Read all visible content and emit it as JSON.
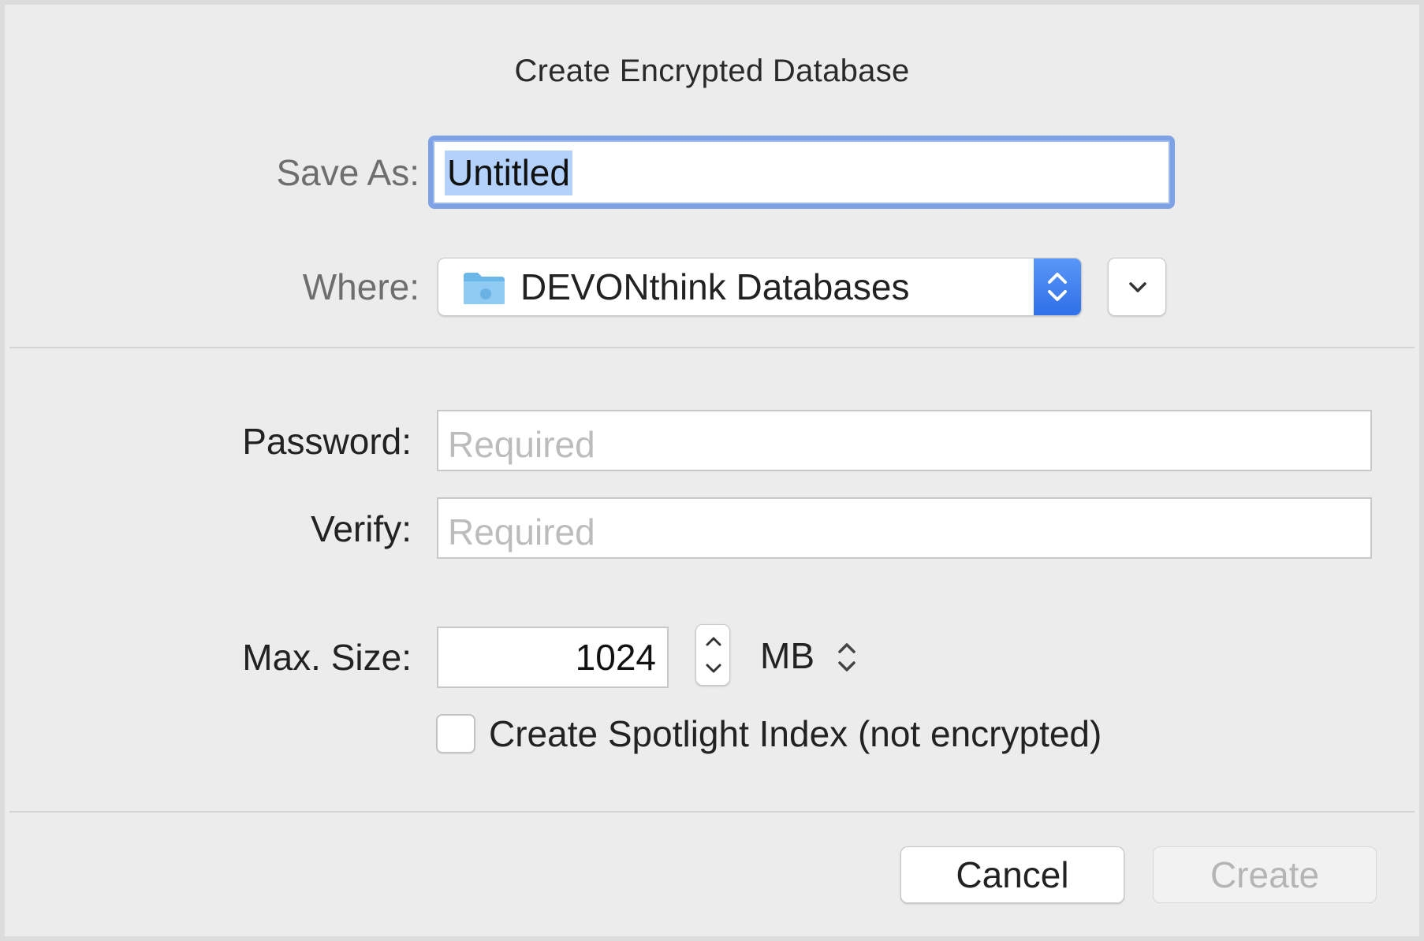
{
  "dialog": {
    "title": "Create Encrypted Database"
  },
  "save_as": {
    "label": "Save As:",
    "value": "Untitled"
  },
  "where": {
    "label": "Where:",
    "value": "DEVONthink Databases",
    "icon": "folder-icon"
  },
  "password": {
    "label": "Password:",
    "placeholder": "Required"
  },
  "verify": {
    "label": "Verify:",
    "placeholder": "Required"
  },
  "max_size": {
    "label": "Max. Size:",
    "value": "1024",
    "unit": "MB"
  },
  "spotlight": {
    "label": "Create Spotlight Index (not encrypted)",
    "checked": false
  },
  "buttons": {
    "cancel": "Cancel",
    "create": "Create"
  },
  "colors": {
    "accent": "#2f6fe8",
    "focus_ring": "#7fa2e6",
    "selection": "#b3d1fb",
    "background": "#ececec"
  }
}
